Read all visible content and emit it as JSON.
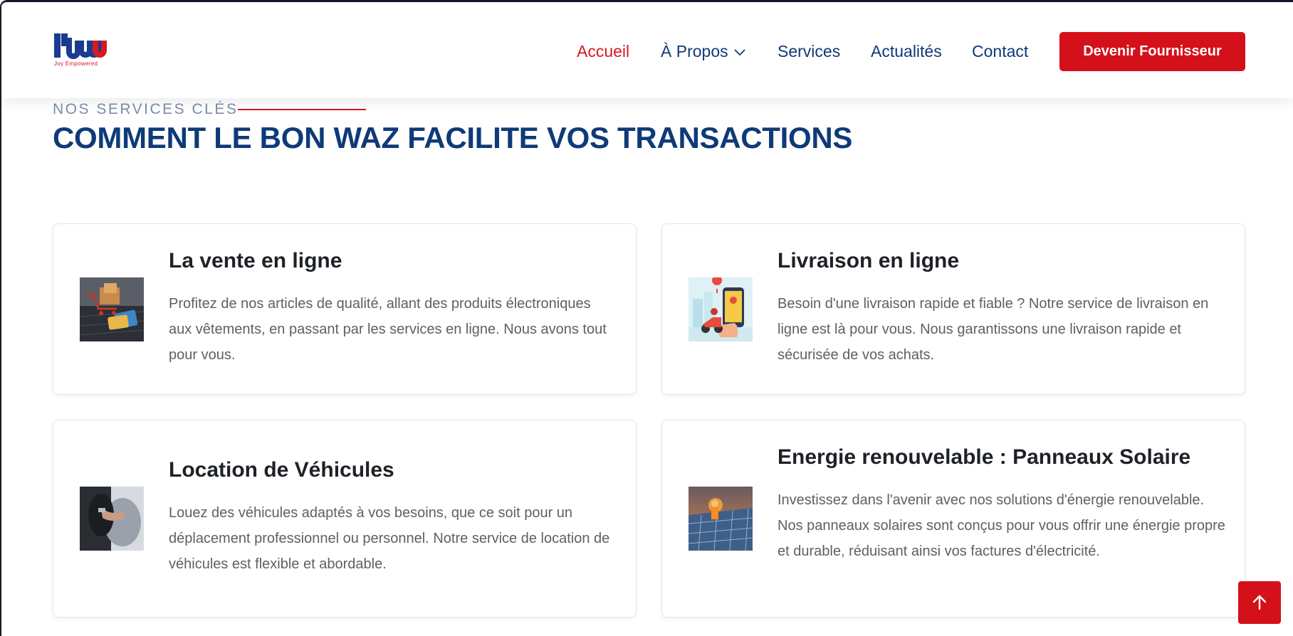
{
  "brand": {
    "logo_text": "lbw",
    "tagline": "Joy Empowered"
  },
  "nav": {
    "items": [
      {
        "label": "Accueil",
        "active": true
      },
      {
        "label": "À Propos",
        "has_dropdown": true
      },
      {
        "label": "Services"
      },
      {
        "label": "Actualités"
      },
      {
        "label": "Contact"
      }
    ],
    "cta_label": "Devenir Fournisseur"
  },
  "section": {
    "eyebrow": "NOS SERVICES CLÉS",
    "title": "COMMENT LE BON WAZ FACILITE VOS TRANSACTIONS"
  },
  "services": [
    {
      "title": "La vente en ligne",
      "text": "Profitez de nos articles de qualité, allant des produits électroniques aux vêtements, en passant par les services en ligne. Nous avons tout pour vous.",
      "icon": "online-shopping-image"
    },
    {
      "title": "Livraison en ligne",
      "text": "Besoin d'une livraison rapide et fiable ? Notre service de livraison en ligne est là pour vous. Nous garantissons une livraison rapide et sécurisée de vos achats.",
      "icon": "delivery-image"
    },
    {
      "title": "Location de Véhicules",
      "text": "Louez des véhicules adaptés à vos besoins, que ce soit pour un déplacement professionnel ou personnel. Notre service de location de véhicules est flexible et abordable.",
      "icon": "car-rental-image"
    },
    {
      "title": "Energie renouvelable : Panneaux Solaire",
      "text": "Investissez dans l'avenir avec nos solutions d'énergie renouvelable. Nos panneaux solaires sont conçus pour vous offrir une énergie propre et durable, réduisant ainsi vos factures d'électricité.",
      "icon": "solar-panel-image"
    }
  ],
  "colors": {
    "brand_red": "#d4101a",
    "navy": "#0e3a78",
    "muted": "#7d8ea8"
  },
  "back_to_top_icon": "arrow-up-icon"
}
